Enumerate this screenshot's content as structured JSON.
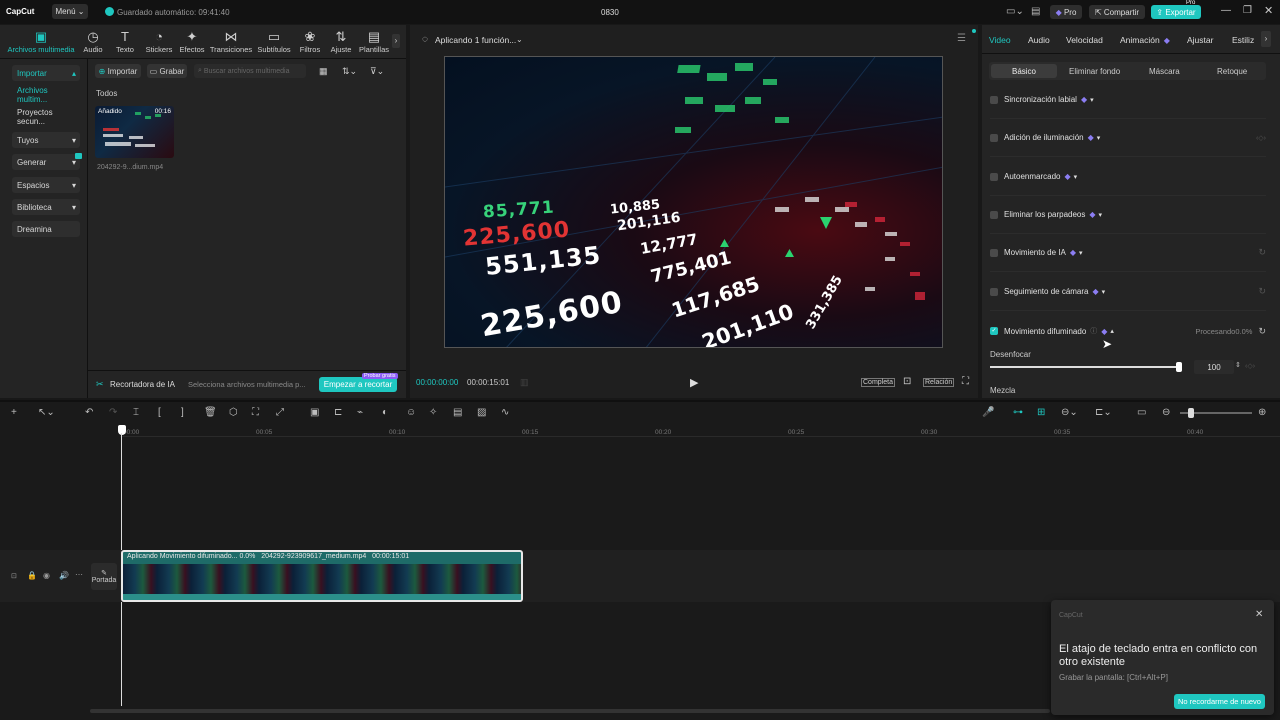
{
  "app": {
    "logo": "CapCut",
    "menu": "Menú",
    "autosave": "Guardado automático: 09:41:40",
    "project": "0830",
    "pro": "Pro",
    "share": "Compartir",
    "export": "Exportar",
    "pro_badge": "Pro"
  },
  "toolbar": [
    {
      "label": "Archivos multimedia",
      "icon": "media-icon",
      "glyph": "▣"
    },
    {
      "label": "Audio",
      "icon": "audio-icon",
      "glyph": "◷"
    },
    {
      "label": "Texto",
      "icon": "text-icon",
      "glyph": "T"
    },
    {
      "label": "Stickers",
      "icon": "sticker-icon",
      "glyph": "◔"
    },
    {
      "label": "Efectos",
      "icon": "effects-icon",
      "glyph": "✦"
    },
    {
      "label": "Transiciones",
      "icon": "transition-icon",
      "glyph": "⋈"
    },
    {
      "label": "Subtítulos",
      "icon": "subtitle-icon",
      "glyph": "▭"
    },
    {
      "label": "Filtros",
      "icon": "filter-icon",
      "glyph": "❀"
    },
    {
      "label": "Ajuste",
      "icon": "adjust-icon",
      "glyph": "⇅"
    },
    {
      "label": "Plantillas",
      "icon": "template-icon",
      "glyph": "▤"
    }
  ],
  "sidebar": [
    {
      "label": "Importar",
      "chev": "▴"
    },
    {
      "label": "Archivos multim..."
    },
    {
      "label": "Proyectos secun..."
    },
    {
      "label": "Tuyos",
      "chev": "▾"
    },
    {
      "label": "Generar",
      "chev": "▾"
    },
    {
      "label": "Espacios",
      "chev": "▾"
    },
    {
      "label": "Biblioteca",
      "chev": "▾"
    },
    {
      "label": "Dreamina"
    }
  ],
  "media": {
    "import": "Importar",
    "record": "Grabar",
    "search_placeholder": "Buscar archivos multimedia",
    "section": "Todos",
    "clip_badge": "Añadido",
    "clip_duration": "00:16",
    "clip_name": "204292-9...dium.mp4",
    "ai_cutter": "Recortadora de IA",
    "ai_hint": "Selecciona archivos multimedia p...",
    "cta": "Empezar a recortar",
    "cta_badge": "Probar gratis"
  },
  "player": {
    "status": "Aplicando 1 función...",
    "time_current": "00:00:00:00",
    "time_total": "00:00:15:01",
    "full": "Completa",
    "ratio": "Relación",
    "overlay": [
      {
        "t": "85,771",
        "c": "#37d27a"
      },
      {
        "t": "225,600",
        "c": "#e23434"
      },
      {
        "t": "551,135",
        "c": "#ffffff"
      },
      {
        "t": "225,600",
        "c": "#ffffff"
      },
      {
        "t": "10,885",
        "c": "#ffffff"
      },
      {
        "t": "201,116",
        "c": "#ffffff"
      },
      {
        "t": "12,777",
        "c": "#ffffff"
      },
      {
        "t": "775,401",
        "c": "#ffffff"
      },
      {
        "t": "117,685",
        "c": "#ffffff"
      },
      {
        "t": "201,110",
        "c": "#ffffff"
      },
      {
        "t": "331,385",
        "c": "#ffffff"
      }
    ]
  },
  "right": {
    "tabs": [
      "Video",
      "Audio",
      "Velocidad",
      "Animación",
      "Ajustar",
      "Estiliz"
    ],
    "subtabs": [
      "Básico",
      "Eliminar fondo",
      "Máscara",
      "Retoque"
    ],
    "rows": [
      {
        "label": "Sincronización labial"
      },
      {
        "label": "Adición de iluminación"
      },
      {
        "label": "Autoenmarcado"
      },
      {
        "label": "Eliminar los parpadeos"
      },
      {
        "label": "Movimiento de IA"
      },
      {
        "label": "Seguimiento de cámara"
      }
    ],
    "motion_blur": {
      "label": "Movimiento difuminado",
      "status": "Procesando0.0%"
    },
    "blur": {
      "label": "Desenfocar",
      "value": "100",
      "level": 100
    },
    "mix": "Mezcla"
  },
  "timeline": {
    "ticks": [
      "00:00",
      "00:05",
      "00:10",
      "00:15",
      "00:20",
      "00:25",
      "00:30",
      "00:35",
      "00:40"
    ],
    "clip_text": "Aplicando Movimiento difuminado... 0.0%   204292-923909617_medium.mp4   00:00:15:01",
    "cover": "Portada"
  },
  "toast": {
    "brand": "CapCut",
    "title": "El atajo de teclado entra en conflicto con otro existente",
    "sub": "Grabar la pantalla: [Ctrl+Alt+P]",
    "btn": "No recordarme de nuevo"
  }
}
